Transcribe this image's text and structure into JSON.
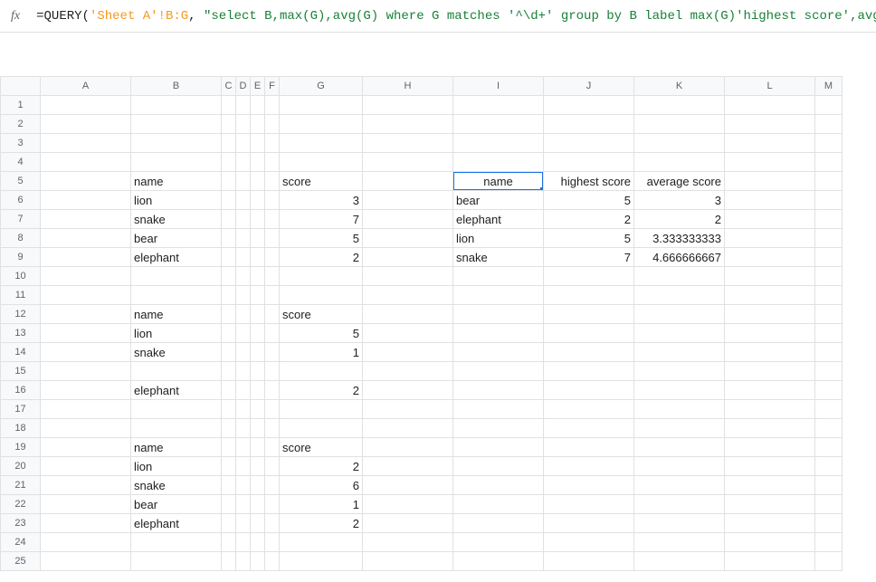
{
  "formula": {
    "prefix": "=",
    "func": "QUERY",
    "open": "(",
    "ref": "'Sheet A'!B:G",
    "comma": ", ",
    "str": "\"select B,max(G),avg(G) where G matches '^\\d+' group by B label max(G)'highest score',avg(G)'average score'\"",
    "close": ")"
  },
  "columns": [
    "A",
    "B",
    "C",
    "D",
    "E",
    "F",
    "G",
    "H",
    "I",
    "J",
    "K",
    "L",
    "M"
  ],
  "selected_cell_text": "name",
  "cells": {
    "B5": "name",
    "G5": "score",
    "J5": "highest score",
    "K5": "average score",
    "B6": "lion",
    "G6": "3",
    "I6": "bear",
    "J6": "5",
    "K6": "3",
    "B7": "snake",
    "G7": "7",
    "I7": "elephant",
    "J7": "2",
    "K7": "2",
    "B8": "bear",
    "G8": "5",
    "I8": "lion",
    "J8": "5",
    "K8": "3.333333333",
    "B9": "elephant",
    "G9": "2",
    "I9": "snake",
    "J9": "7",
    "K9": "4.666666667",
    "B12": "name",
    "G12": "score",
    "B13": "lion",
    "G13": "5",
    "B14": "snake",
    "G14": "1",
    "B16": "elephant",
    "G16": "2",
    "B19": "name",
    "G19": "score",
    "B20": "lion",
    "G20": "2",
    "B21": "snake",
    "G21": "6",
    "B22": "bear",
    "G22": "1",
    "B23": "elephant",
    "G23": "2"
  },
  "row_count": 25
}
